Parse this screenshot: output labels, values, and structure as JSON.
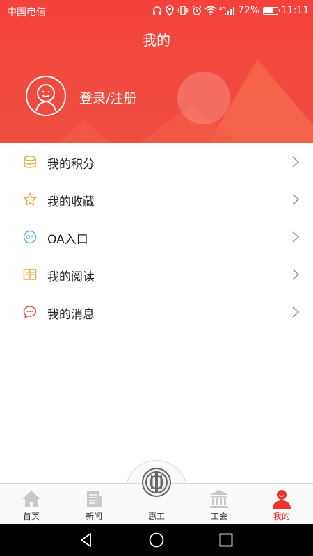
{
  "status_bar": {
    "carrier": "中国电信",
    "battery_percent": "72%",
    "battery_level": 0.72,
    "time": "11:11",
    "network_label": "4G"
  },
  "header": {
    "title": "我的",
    "login_label": "登录/注册",
    "colors": {
      "primary": "#f2453d",
      "accent": "#f5684a"
    }
  },
  "menu": {
    "items": [
      {
        "label": "我的积分",
        "icon": "coins-icon",
        "color": "#d9b44a"
      },
      {
        "label": "我的收藏",
        "icon": "star-icon",
        "color": "#eea23c"
      },
      {
        "label": "OA入口",
        "icon": "oa-icon",
        "icon_text": "OA",
        "color": "#4fb3d9"
      },
      {
        "label": "我的阅读",
        "icon": "book-icon",
        "color": "#eea23c"
      },
      {
        "label": "我的消息",
        "icon": "message-icon",
        "color": "#e8504a"
      }
    ]
  },
  "tabbar": {
    "tabs": [
      {
        "label": "首页",
        "icon": "home-icon",
        "active": false
      },
      {
        "label": "新闻",
        "icon": "news-icon",
        "active": false
      },
      {
        "label": "惠工",
        "icon": "union-logo-icon",
        "active": false
      },
      {
        "label": "工会",
        "icon": "building-icon",
        "active": false
      },
      {
        "label": "我的",
        "icon": "person-icon",
        "active": true
      }
    ],
    "active_color": "#e8342d",
    "inactive_color": "#c8c8c8"
  },
  "navbar": {
    "buttons": [
      "back-icon",
      "home-circle-icon",
      "recents-icon"
    ]
  }
}
